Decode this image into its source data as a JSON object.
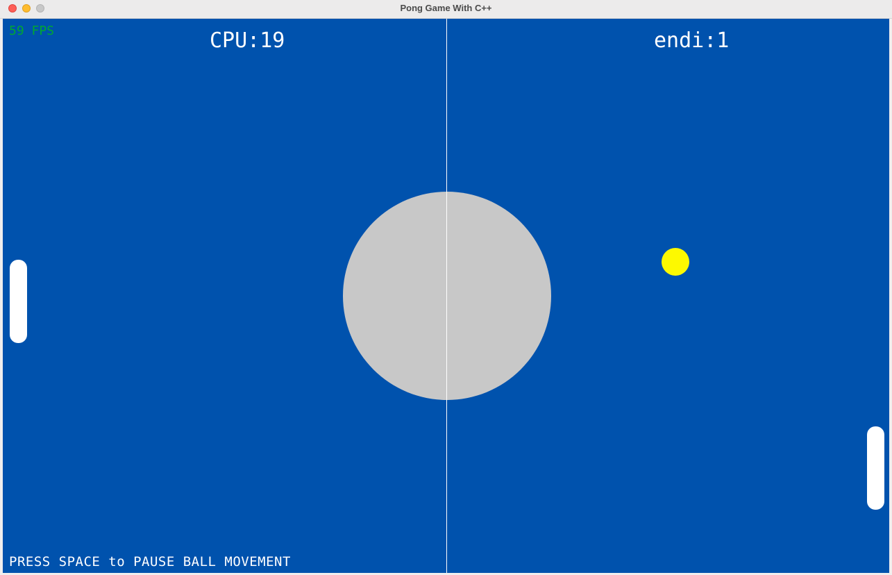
{
  "window": {
    "title": "Pong Game With C++"
  },
  "colors": {
    "field": "#0052ad",
    "center_circle": "#c8c8c8",
    "ball": "#fdf900",
    "fps": "#00a832",
    "text": "#ffffff",
    "paddle": "#ffffff"
  },
  "hud": {
    "fps_text": "59 FPS",
    "cpu_score_text": "CPU:19",
    "player_score_text": "endi:1",
    "hint_text": "PRESS SPACE to PAUSE BALL MOVEMENT"
  },
  "scores": {
    "cpu": 19,
    "player": 1,
    "player_name": "endi"
  }
}
